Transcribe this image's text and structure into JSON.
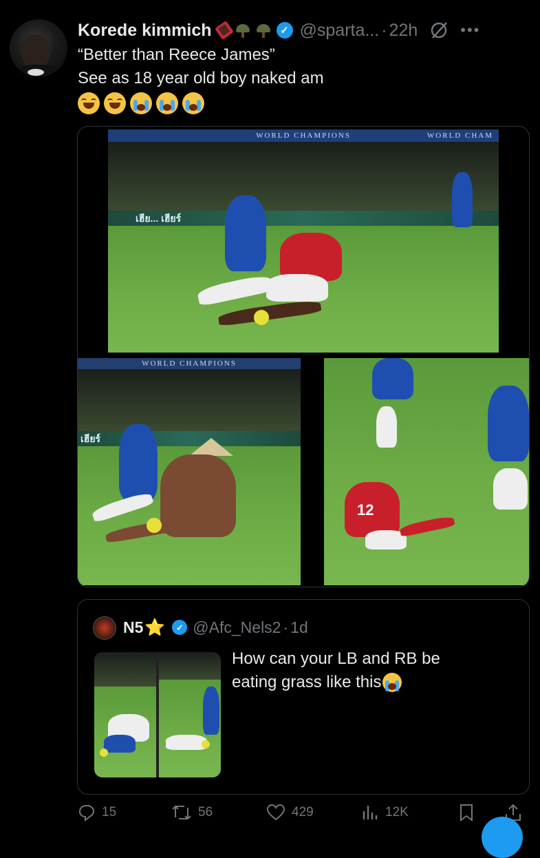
{
  "tweet": {
    "author_name": "Korede kimmich",
    "handle": "@sparta...",
    "separator": "·",
    "time": "22h",
    "line1": "“Better than Reece James”",
    "line2": "See as 18 year old boy naked am"
  },
  "media": {
    "banner_top": "WORLD CHAMPIONS",
    "banner_top_right": "WORLD CHAM",
    "banner_bottom": "WORLD CHAMPIONS",
    "adboard_top": "เฮีย... เฮียร์",
    "adboard_bottom": "เฮียร์",
    "shirt_number": "12"
  },
  "quote": {
    "author_name": "N5",
    "star": "⭐",
    "handle": "@Afc_Nels2",
    "separator": "·",
    "time": "1d",
    "line1": "How can your LB and RB be",
    "line2": "eating grass like this"
  },
  "actions": {
    "replies": "15",
    "reposts": "56",
    "likes": "429",
    "views": "12K"
  },
  "colors": {
    "background": "#000000",
    "text": "#e7e9ea",
    "muted": "#71767b",
    "verified": "#1d9bf0",
    "border": "#2f3336"
  }
}
